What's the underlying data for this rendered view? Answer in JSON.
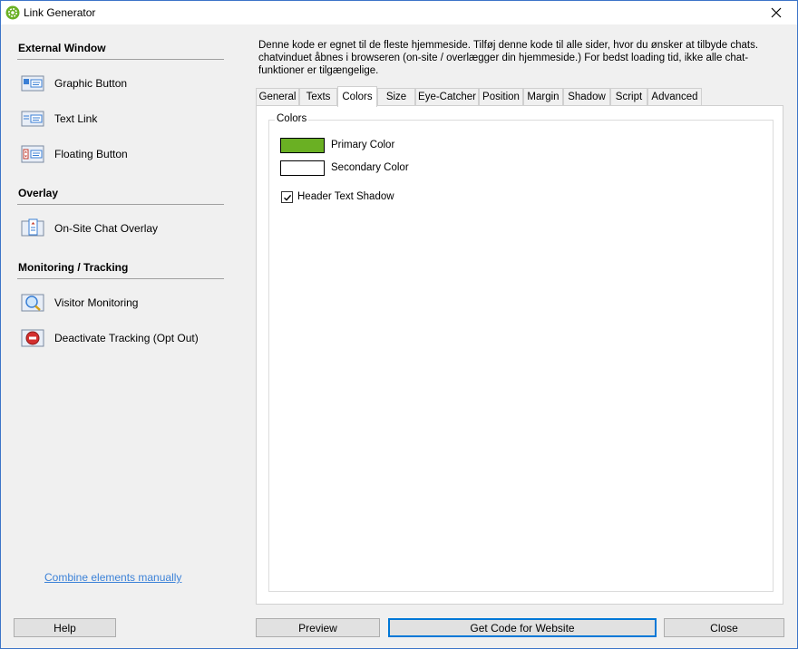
{
  "window": {
    "title": "Link Generator",
    "app_icon": "gear-icon",
    "close_icon": "close-icon"
  },
  "sidebar": {
    "sections": [
      {
        "header": "External Window",
        "items": [
          {
            "label": "Graphic Button",
            "icon": "graphic-button-icon"
          },
          {
            "label": "Text Link",
            "icon": "text-link-icon"
          },
          {
            "label": "Floating Button",
            "icon": "floating-button-icon"
          }
        ]
      },
      {
        "header": "Overlay",
        "items": [
          {
            "label": "On-Site Chat Overlay",
            "icon": "chat-overlay-icon"
          }
        ]
      },
      {
        "header": "Monitoring / Tracking",
        "items": [
          {
            "label": "Visitor Monitoring",
            "icon": "visitor-monitoring-icon"
          },
          {
            "label": "Deactivate Tracking (Opt Out)",
            "icon": "deactivate-tracking-icon"
          }
        ]
      }
    ],
    "combine_link": "Combine elements manually",
    "help_button": "Help"
  },
  "main": {
    "description": "Denne kode er egnet til de fleste hjemmeside. Tilføj denne kode til alle sider, hvor du ønsker at tilbyde chats. chatvinduet åbnes i browseren (on-site / overlægger din hjemmeside.) For bedst loading tid, ikke alle chat-funktioner er tilgængelige.",
    "tabs": [
      "General",
      "Texts",
      "Colors",
      "Size",
      "Eye-Catcher",
      "Position",
      "Margin",
      "Shadow",
      "Script",
      "Advanced"
    ],
    "active_tab": "Colors",
    "colors_group": {
      "title": "Colors",
      "primary_label": "Primary Color",
      "primary_color": "#6ab023",
      "secondary_label": "Secondary Color",
      "secondary_color": "#ffffff",
      "header_shadow_label": "Header Text Shadow",
      "header_shadow_checked": true
    }
  },
  "footer": {
    "preview_button": "Preview",
    "get_code_button": "Get Code for Website",
    "close_button": "Close"
  }
}
